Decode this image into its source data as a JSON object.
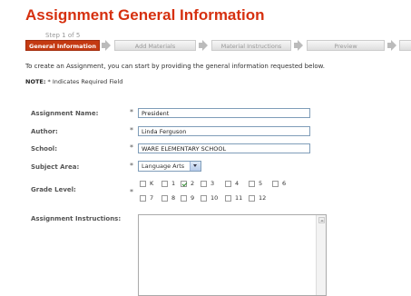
{
  "page": {
    "title": "Assignment General Information"
  },
  "wizard": {
    "step_text": "Step 1 of 5",
    "steps": [
      "General Information",
      "Add Materials",
      "Material Instructions",
      "Preview"
    ]
  },
  "intro": "To create an Assignment, you can start by providing the general information requested below.",
  "note": {
    "prefix": "NOTE:",
    "text": " * Indicates Required Field"
  },
  "form": {
    "required_mark": "*",
    "assignment_name": {
      "label": "Assignment Name:",
      "value": "President"
    },
    "author": {
      "label": "Author:",
      "value": "Linda Ferguson"
    },
    "school": {
      "label": "School:",
      "value": "WARE ELEMENTARY SCHOOL"
    },
    "subject_area": {
      "label": "Subject Area:",
      "value": "Language Arts"
    },
    "grade_level": {
      "label": "Grade Level:",
      "grades": [
        "K",
        "1",
        "2",
        "3",
        "4",
        "5",
        "6",
        "7",
        "8",
        "9",
        "10",
        "11",
        "12"
      ],
      "checked": [
        "2"
      ]
    },
    "assignment_instructions": {
      "label": "Assignment Instructions:",
      "value": ""
    }
  },
  "colors": {
    "title": "#d6300f",
    "active_step": "#c43a12"
  }
}
